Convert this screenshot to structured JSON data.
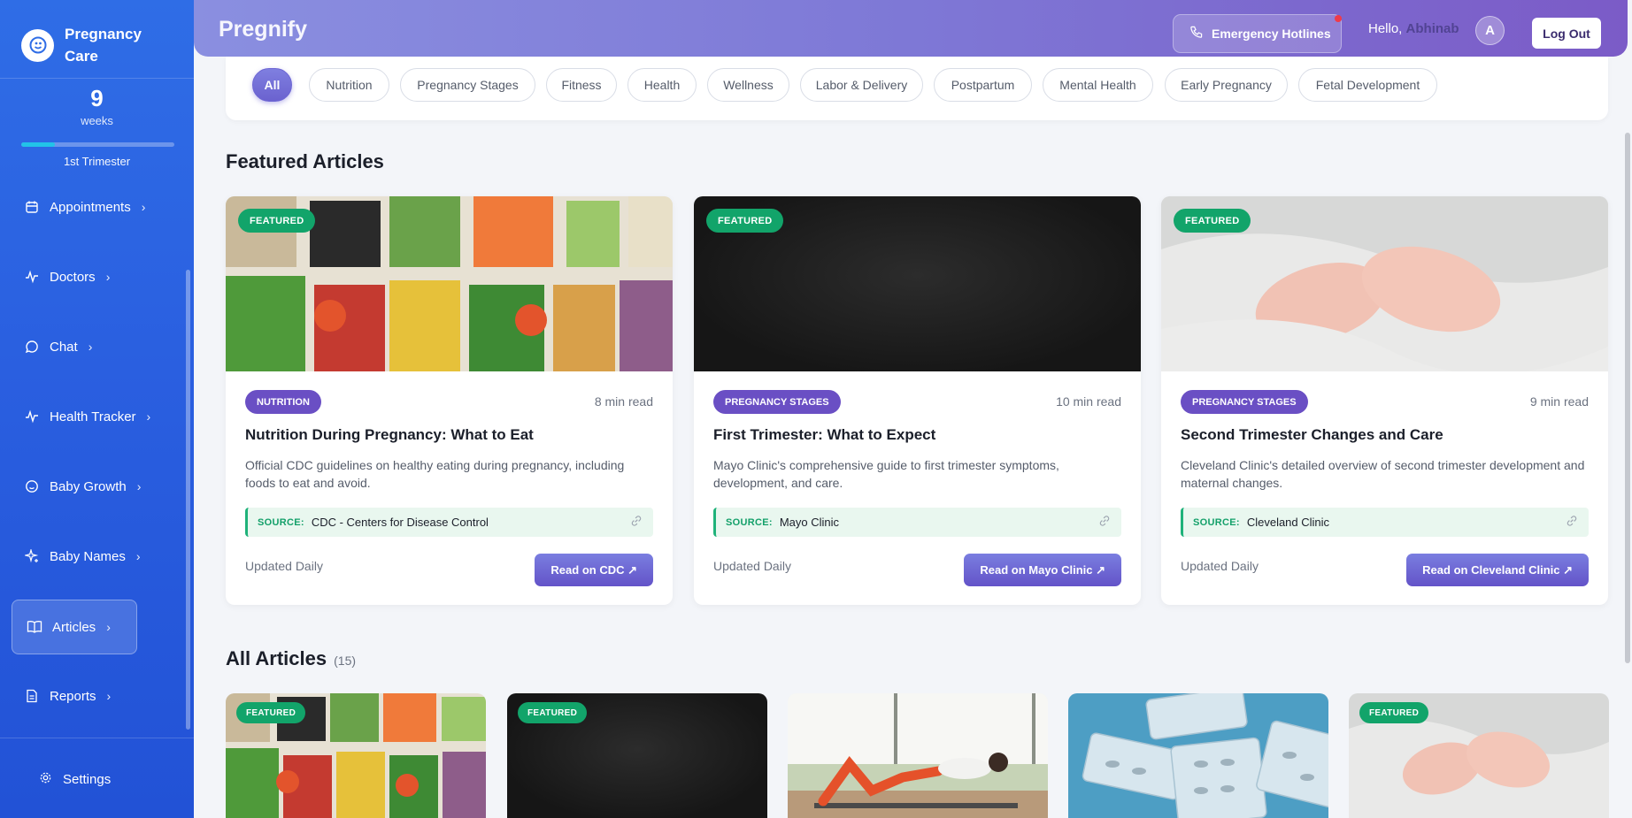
{
  "sidebar": {
    "brand": "Pregnancy Care",
    "week_number": "9",
    "week_unit": "weeks",
    "progress_fraction": 0.22,
    "trimester": "1st Trimester",
    "items": [
      {
        "label": "Appointments"
      },
      {
        "label": "Doctors"
      },
      {
        "label": "Chat"
      },
      {
        "label": "Health Tracker"
      },
      {
        "label": "Baby Growth"
      },
      {
        "label": "Baby Names"
      },
      {
        "label": "Articles"
      },
      {
        "label": "Reports"
      }
    ],
    "settings": "Settings"
  },
  "header": {
    "title": "Pregnify",
    "emergency": "Emergency Hotlines",
    "hello": "Hello,",
    "user": "Abhinab",
    "avatar_initial": "A",
    "logout": "Log Out"
  },
  "filters": [
    "All",
    "Nutrition",
    "Pregnancy Stages",
    "Fitness",
    "Health",
    "Wellness",
    "Labor & Delivery",
    "Postpartum",
    "Mental Health",
    "Early Pregnancy",
    "Fetal Development"
  ],
  "featured": {
    "title": "Featured Articles",
    "badge": "FEATURED",
    "source_label": "SOURCE:",
    "updated": "Updated Daily",
    "cards": [
      {
        "category": "NUTRITION",
        "read_time": "8 min read",
        "title": "Nutrition During Pregnancy: What to Eat",
        "desc": "Official CDC guidelines on healthy eating during pregnancy, including foods to eat and avoid.",
        "source": "CDC - Centers for Disease Control",
        "button": "Read on CDC ↗"
      },
      {
        "category": "PREGNANCY STAGES",
        "read_time": "10 min read",
        "title": "First Trimester: What to Expect",
        "desc": "Mayo Clinic's comprehensive guide to first trimester symptoms, development, and care.",
        "source": "Mayo Clinic",
        "button": "Read on Mayo Clinic ↗"
      },
      {
        "category": "PREGNANCY STAGES",
        "read_time": "9 min read",
        "title": "Second Trimester Changes and Care",
        "desc": "Cleveland Clinic's detailed overview of second trimester development and maternal changes.",
        "source": "Cleveland Clinic",
        "button": "Read on Cleveland Clinic ↗"
      }
    ]
  },
  "all_articles": {
    "title": "All Articles",
    "count": "(15)",
    "badge": "FEATURED"
  }
}
